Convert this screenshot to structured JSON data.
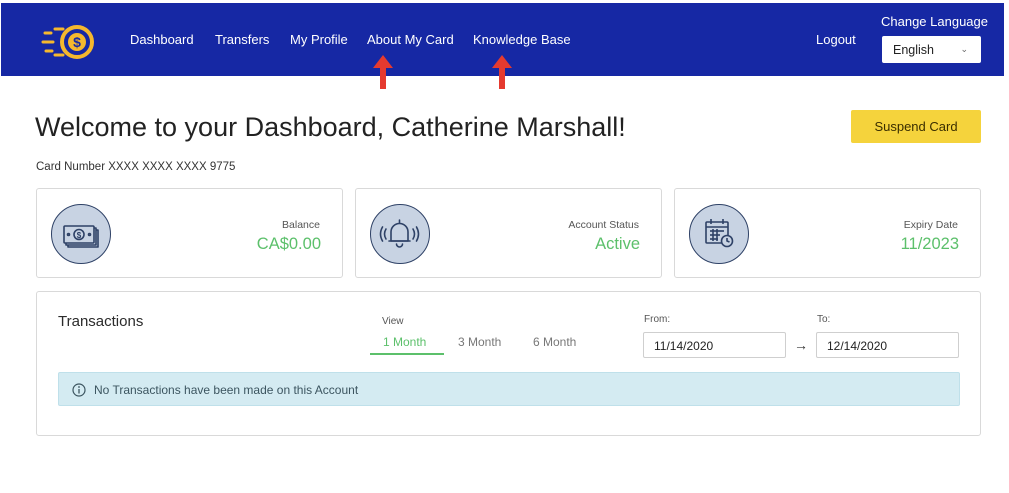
{
  "nav": {
    "items": [
      {
        "label": "Dashboard"
      },
      {
        "label": "Transfers"
      },
      {
        "label": "My Profile"
      },
      {
        "label": "About My Card"
      },
      {
        "label": "Knowledge Base"
      }
    ],
    "logout": "Logout",
    "language": {
      "label": "Change Language",
      "selected": "English"
    }
  },
  "header": {
    "welcome": "Welcome to your Dashboard, Catherine Marshall!",
    "card_number": "Card Number XXXX XXXX XXXX 9775",
    "suspend_label": "Suspend Card"
  },
  "stats": [
    {
      "icon": "money-icon",
      "label": "Balance",
      "value": "CA$0.00"
    },
    {
      "icon": "bell-icon",
      "label": "Account Status",
      "value": "Active"
    },
    {
      "icon": "calendar-icon",
      "label": "Expiry Date",
      "value": "11/2023"
    }
  ],
  "transactions": {
    "title": "Transactions",
    "view_label": "View",
    "periods": [
      {
        "label": "1 Month",
        "active": true
      },
      {
        "label": "3 Month",
        "active": false
      },
      {
        "label": "6 Month",
        "active": false
      }
    ],
    "from_label": "From:",
    "from_value": "11/14/2020",
    "to_label": "To:",
    "to_value": "12/14/2020",
    "empty_message": "No Transactions have been made on this Account"
  },
  "colors": {
    "navbar": "#1628a4",
    "accent_green": "#5cc06b",
    "suspend_yellow": "#f5d33c",
    "alert_bg": "#d4ebf2",
    "annotation_red": "#e53a2f"
  }
}
